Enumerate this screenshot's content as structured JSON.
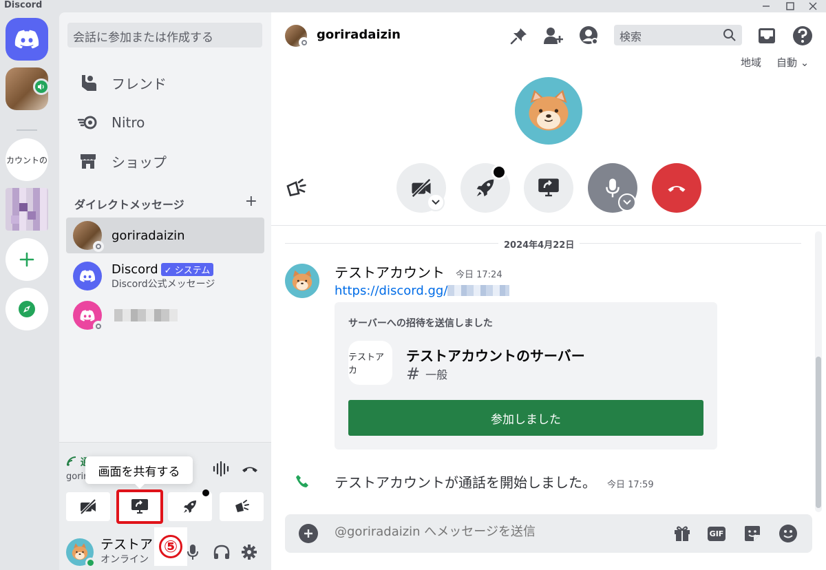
{
  "window": {
    "title": "Discord"
  },
  "rail": {
    "text_server": "カウントの"
  },
  "sidebar": {
    "search_placeholder": "会話に参加または作成する",
    "nav": [
      {
        "label": "フレンド",
        "icon": "friends-icon"
      },
      {
        "label": "Nitro",
        "icon": "nitro-icon"
      },
      {
        "label": "ショップ",
        "icon": "shop-icon"
      }
    ],
    "dm_header": "ダイレクトメッセージ",
    "dm_add": "+",
    "dms": [
      {
        "name": "goriradaizin"
      },
      {
        "name": "Discord",
        "badge": "✓ システム",
        "sub": "Discord公式メッセージ"
      }
    ]
  },
  "voice": {
    "connection": "通話",
    "subtitle": "gorir",
    "tooltip": "画面を共有する",
    "step_badge": "⑤"
  },
  "user": {
    "name": "テストア...",
    "status": "オンライン"
  },
  "header": {
    "name": "goriradaizin",
    "search_placeholder": "検索",
    "region_label": "地域",
    "region_value": "自動 ⌄"
  },
  "chat": {
    "date": "2024年4月22日",
    "message": {
      "author": "テストアカウント",
      "time": "今日 17:24",
      "link": "https://discord.gg/"
    },
    "invite": {
      "title": "サーバーへの招待を送信しました",
      "icon_text": "テストアカ",
      "server_name": "テストアカウントのサーバー",
      "channel": "一般",
      "button": "参加しました"
    },
    "call_event": {
      "text": "テストアカウントが通話を開始しました。",
      "time": "今日 17:59"
    }
  },
  "composer": {
    "placeholder": "@goriradaizin へメッセージを送信",
    "gif_label": "GIF"
  },
  "colors": {
    "blurple": "#5865f2",
    "green": "#248046",
    "online": "#23a55a",
    "danger": "#da373c",
    "highlight": "#e0131a"
  }
}
